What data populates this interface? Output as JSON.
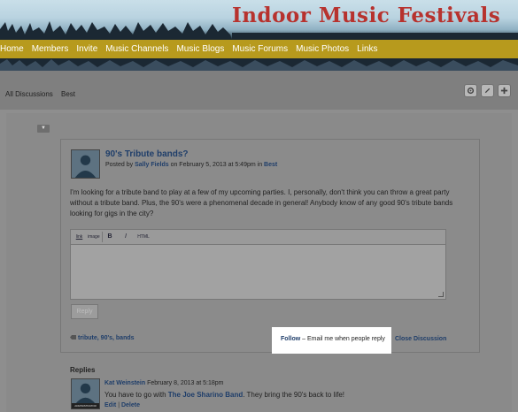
{
  "site": {
    "title": "Indoor Music Festivals"
  },
  "nav": {
    "items": [
      "Home",
      "Members",
      "Invite",
      "Music Channels",
      "Music Blogs",
      "Music Forums",
      "Music Photos",
      "Links"
    ]
  },
  "tabs": {
    "all_discussions": "All Discussions",
    "best": "Best"
  },
  "toolbar_icons": [
    "gear-icon",
    "pencil-icon",
    "plus-icon"
  ],
  "post": {
    "title": "90's Tribute bands?",
    "meta_prefix": "Posted by",
    "author": "Sally Fields",
    "meta_middle": "on February 5, 2013 at 5:49pm in",
    "category": "Best",
    "body": "I'm looking for a tribute band to play at a few of my upcoming parties. I, personally, don't think you can throw a great party without a tribute band. Plus, the 90's were a phenomenal decade in general!  Anybody know of any good 90's tribute bands looking for gigs in the city?"
  },
  "editor": {
    "buttons": [
      "link",
      "image",
      "B",
      "I",
      "HTML"
    ],
    "value": "",
    "reply_label": "Reply"
  },
  "tags": {
    "tag1": "tribute",
    "sep1": ", ",
    "tag2": "90's",
    "sep2": ", ",
    "tag3": "bands"
  },
  "follow": {
    "link": "Follow",
    "description": " – Email me when people reply"
  },
  "close_label": "Close Discussion",
  "replies": {
    "heading": "Replies",
    "items": [
      {
        "author": "Kat Weinstein",
        "date": "February 8, 2013 at 5:18pm",
        "text_prefix": "You have to go with ",
        "text_link": "The Joe Sharino Band",
        "text_suffix": ". They bring the 90's back to life!",
        "badge": "ADMINISTRATOR",
        "edit": "Edit",
        "delete": "Delete"
      }
    ]
  },
  "colors": {
    "title_red": "#b7322e",
    "nav_gold": "#b79a1d",
    "link_blue": "#1f3e6a",
    "follow_highlight": "#ffffff"
  }
}
